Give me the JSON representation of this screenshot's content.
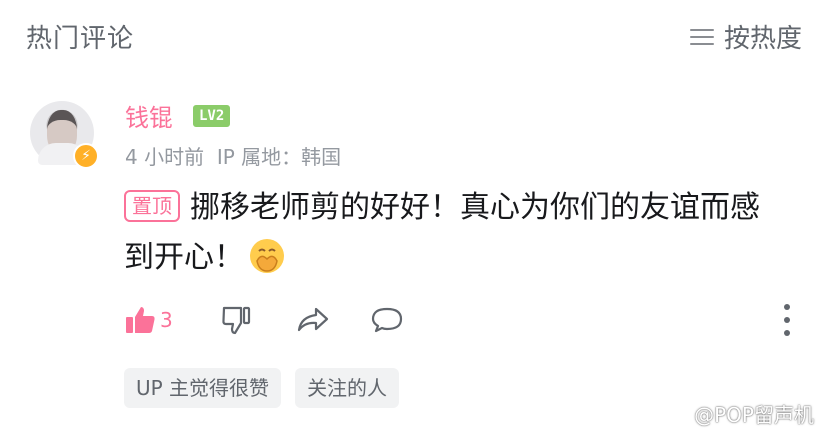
{
  "header": {
    "title": "热门评论",
    "sort_label": "按热度"
  },
  "comment": {
    "username": "钱锟",
    "level": "LV2",
    "time": "4 小时前",
    "ip_location": "IP 属地：韩国",
    "pinned_label": "置顶",
    "text": "挪移老师剪的好好！真心为你们的友谊而感到开心！",
    "emoji": "hands-covering-mouth-emoji",
    "like_count": "3"
  },
  "tags": [
    {
      "label": "UP 主觉得很赞"
    },
    {
      "label": "关注的人"
    }
  ],
  "watermark": {
    "text": "@POP留声机"
  },
  "colors": {
    "accent": "#fb7299",
    "level": "#8bcc69",
    "muted": "#9499a0"
  }
}
